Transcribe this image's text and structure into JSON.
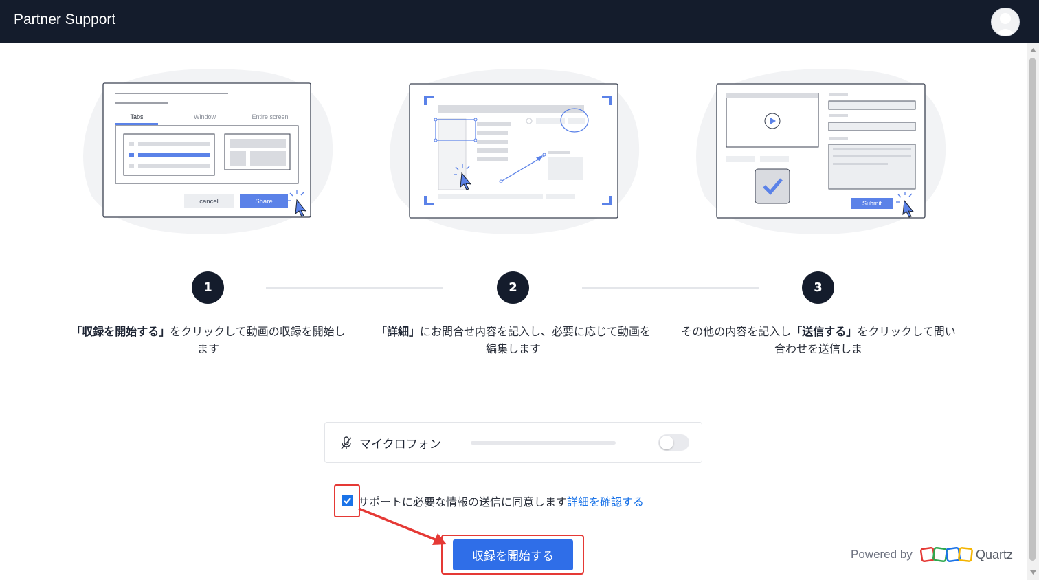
{
  "header": {
    "title": "Partner Support"
  },
  "illustrations": {
    "one": {
      "tab_tabs": "Tabs",
      "tab_window": "Window",
      "tab_entire": "Entire screen",
      "cancel_label": "cancel",
      "share_label": "Share"
    },
    "three": {
      "submit_label": "Submit"
    }
  },
  "steps": [
    {
      "number": "1",
      "bold": "「収録を開始する」",
      "text": "をクリックして動画の収録を開始します"
    },
    {
      "number": "2",
      "bold": "「詳細」",
      "text": "にお問合せ内容を記入し、必要に応じて動画を編集します"
    },
    {
      "number": "3",
      "pre": "その他の内容を記入し",
      "bold": "「送信する」",
      "text": "をクリックして問い合わせを送信しま"
    }
  ],
  "mic": {
    "label": "マイクロフォン",
    "enabled": false
  },
  "consent": {
    "checked": true,
    "text": "サポートに必要な情報の送信に同意します",
    "link": "詳細を確認する"
  },
  "start_button": {
    "label": "収録を開始する"
  },
  "footer": {
    "powered_by": "Powered by",
    "brand": "Quartz"
  },
  "colors": {
    "header_bg": "#141c2c",
    "accent": "#2f6ee8",
    "annotation": "#e53935",
    "illustration_accent": "#5b82e8"
  }
}
